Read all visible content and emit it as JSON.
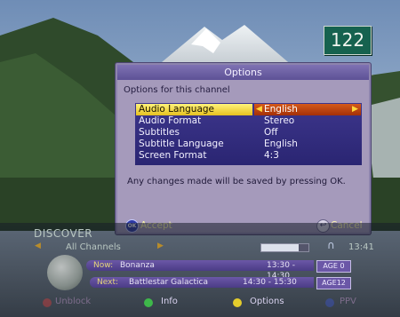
{
  "channel_number": "122",
  "dialog": {
    "title": "Options",
    "subtitle": "Options for this channel",
    "rows": [
      {
        "label": "Audio Language",
        "value": "English",
        "selected": true
      },
      {
        "label": "Audio Format",
        "value": "Stereo"
      },
      {
        "label": "Subtitles",
        "value": "Off"
      },
      {
        "label": "Subtitle Language",
        "value": "English"
      },
      {
        "label": "Screen Format",
        "value": "4:3"
      }
    ],
    "note": "Any changes made will be saved by pressing OK.",
    "ok_icon": "OK",
    "accept_label": "Accept",
    "cancel_label": "Cancel"
  },
  "banner": {
    "channel_name": "DISCOVER",
    "channel_list": "All Channels",
    "signal_level": 0.8,
    "clock": "13:41",
    "now": {
      "label": "Now:",
      "title": "Bonanza",
      "time": "13:30 - 14:30",
      "age": "AGE 0"
    },
    "next": {
      "label": "Next:",
      "title": "Battlestar Galactica",
      "time": "14:30 - 15:30",
      "age": "AGE12"
    },
    "keys": [
      {
        "label": "Unblock",
        "color": "#d23c3c",
        "dim": true
      },
      {
        "label": "Info",
        "color": "#3eb84a",
        "dim": false
      },
      {
        "label": "Options",
        "color": "#e4cc2c",
        "dim": false
      },
      {
        "label": "PPV",
        "color": "#3b55c9",
        "dim": true
      }
    ]
  },
  "colors": {
    "dialog_bg": "#a59abb",
    "menu_bg": "#3d368c",
    "highlight": "#f4dd4b",
    "value_highlight": "#c54a14",
    "channel_box": "#16624f"
  }
}
